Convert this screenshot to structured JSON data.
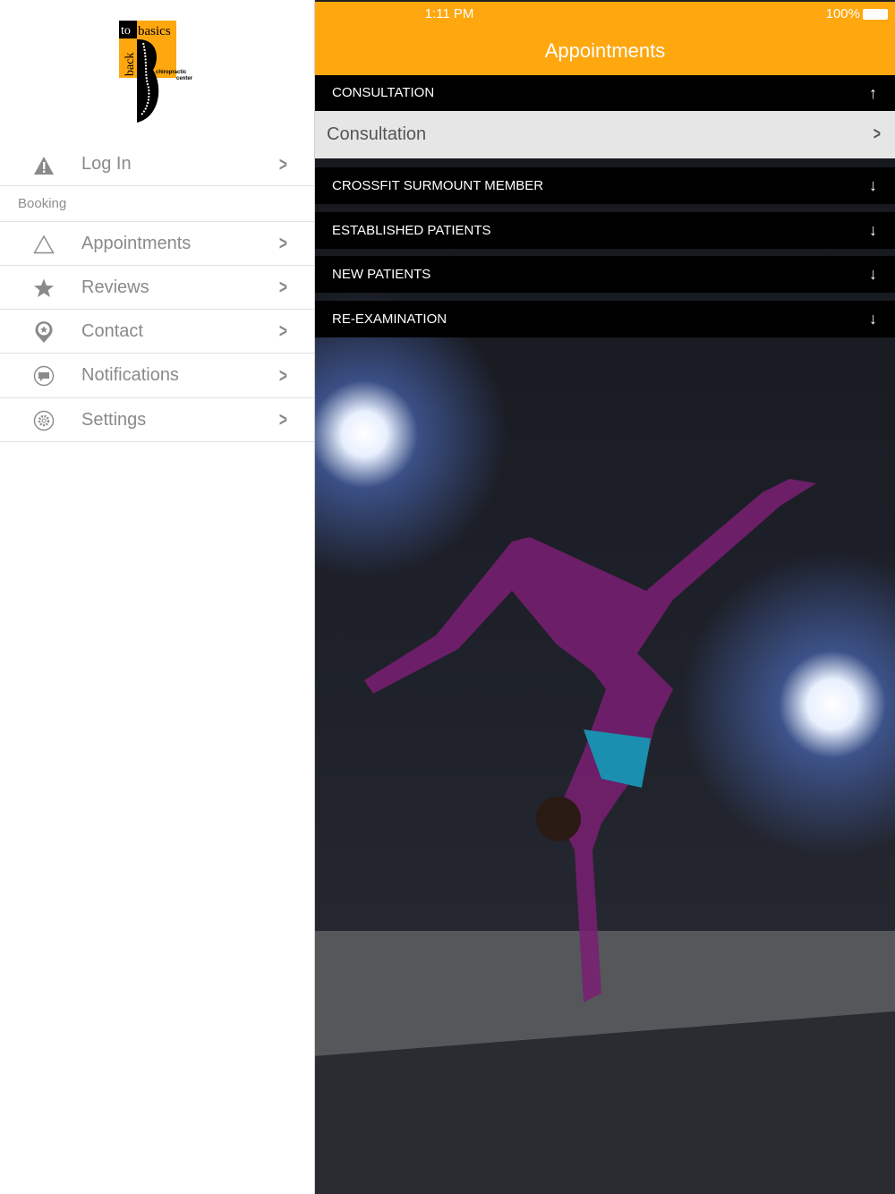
{
  "logo": {
    "text_top": "to basics",
    "text_side": "back",
    "subtitle": "chiropractic center"
  },
  "sidebar": {
    "login": {
      "label": "Log In",
      "icon": "warning-icon"
    },
    "section": "Booking",
    "items": [
      {
        "label": "Appointments",
        "icon": "triangle-icon"
      },
      {
        "label": "Reviews",
        "icon": "star-icon"
      },
      {
        "label": "Contact",
        "icon": "location-pin-icon"
      },
      {
        "label": "Notifications",
        "icon": "chat-bubble-icon"
      },
      {
        "label": "Settings",
        "icon": "gear-icon"
      }
    ]
  },
  "status": {
    "time": "1:11 PM",
    "battery": "100%"
  },
  "header": {
    "title": "Appointments",
    "color": "#fea70f"
  },
  "accordion": [
    {
      "label": "CONSULTATION",
      "expanded": true,
      "children": [
        "Consultation"
      ]
    },
    {
      "label": "CROSSFIT SURMOUNT MEMBER",
      "expanded": false
    },
    {
      "label": "ESTABLISHED PATIENTS",
      "expanded": false
    },
    {
      "label": "NEW PATIENTS",
      "expanded": false
    },
    {
      "label": "RE-EXAMINATION",
      "expanded": false
    }
  ]
}
